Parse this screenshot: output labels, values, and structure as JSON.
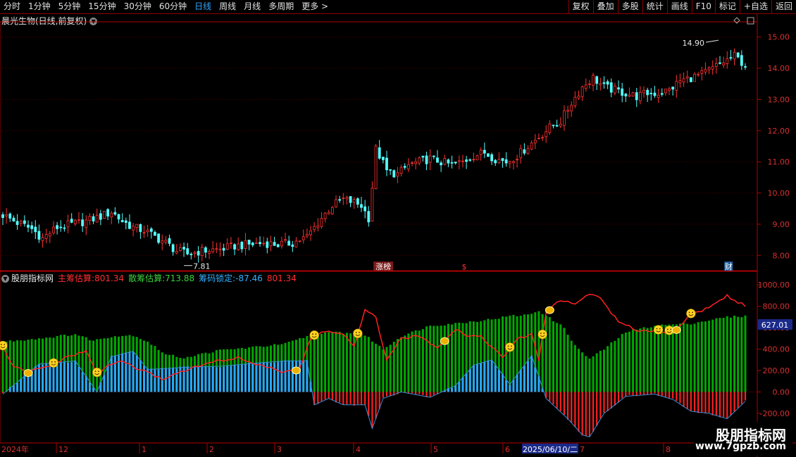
{
  "toolbar": {
    "periods": [
      "分时",
      "1分钟",
      "5分钟",
      "15分钟",
      "30分钟",
      "60分钟",
      "日线",
      "周线",
      "月线",
      "多周期",
      "更多 >"
    ],
    "active_period": "日线",
    "buttons": [
      "复权",
      "叠加",
      "多股",
      "统计",
      "画线",
      "F10",
      "标记",
      "+自选",
      "返回"
    ]
  },
  "chart_title": "晨光生物(日线,前复权)",
  "indicator": {
    "name": "股朋指标网",
    "main_label": "主筹估算:",
    "main_value": "801.34",
    "scatter_label": "散筹估算:",
    "scatter_value": "713.88",
    "lock_label": "筹码锁定:",
    "lock_value": "-87.46",
    "extra_value": "801.34",
    "cursor_value": "627.01"
  },
  "annotations": {
    "high_label": "14.90",
    "low_label": "7.81",
    "event_zhangbang": "涨榜",
    "event_s": "$",
    "event_cai": "财"
  },
  "xaxis": {
    "year_label": "2024年",
    "months": [
      "12",
      "1",
      "2",
      "3",
      "4",
      "5",
      "6",
      "7",
      "8"
    ],
    "highlight_date": "2025/06/10/二"
  },
  "watermark": {
    "line1": "股朋指标网",
    "line2": "www.7gpzb.com"
  },
  "colors": {
    "up": "#ff3232",
    "down": "#54ffff",
    "green": "#00a800",
    "blue": "#29a8ff",
    "red": "#ff2020",
    "line": "#ff2020",
    "axis": "#b00000"
  },
  "chart_data": [
    {
      "type": "candlestick",
      "title": "晨光生物(日线,前复权)",
      "ylim": [
        7.6,
        15.4
      ],
      "yticks": [
        8.0,
        9.0,
        10.0,
        11.0,
        12.0,
        13.0,
        14.0,
        15.0
      ],
      "close_path": [
        [
          0,
          9.3
        ],
        [
          4,
          9.05
        ],
        [
          8,
          8.85
        ],
        [
          11,
          8.55
        ],
        [
          15,
          8.9
        ],
        [
          19,
          9.0
        ],
        [
          23,
          9.1
        ],
        [
          27,
          9.25
        ],
        [
          30,
          9.4
        ],
        [
          33,
          9.1
        ],
        [
          36,
          8.9
        ],
        [
          39,
          8.8
        ],
        [
          42,
          8.6
        ],
        [
          45,
          8.4
        ],
        [
          48,
          8.15
        ],
        [
          51,
          8.05
        ],
        [
          55,
          8.15
        ],
        [
          60,
          8.2
        ],
        [
          64,
          8.3
        ],
        [
          68,
          8.35
        ],
        [
          72,
          8.4
        ],
        [
          76,
          8.35
        ],
        [
          80,
          8.4
        ],
        [
          84,
          8.6
        ],
        [
          88,
          9.2
        ],
        [
          91,
          9.6
        ],
        [
          94,
          9.8
        ],
        [
          97,
          9.7
        ],
        [
          99,
          9.6
        ],
        [
          101,
          9.2
        ],
        [
          102,
          10.2
        ],
        [
          103,
          11.4
        ],
        [
          104,
          11.2
        ],
        [
          106,
          10.7
        ],
        [
          109,
          10.6
        ],
        [
          112,
          10.9
        ],
        [
          115,
          11.0
        ],
        [
          118,
          11.1
        ],
        [
          121,
          11.0
        ],
        [
          124,
          10.9
        ],
        [
          127,
          11.0
        ],
        [
          130,
          11.2
        ],
        [
          133,
          11.3
        ],
        [
          136,
          11.1
        ],
        [
          139,
          11.0
        ],
        [
          142,
          11.2
        ],
        [
          145,
          11.5
        ],
        [
          148,
          11.8
        ],
        [
          151,
          12.1
        ],
        [
          154,
          12.3
        ],
        [
          157,
          12.9
        ],
        [
          160,
          13.4
        ],
        [
          163,
          13.7
        ],
        [
          166,
          13.4
        ],
        [
          169,
          13.3
        ],
        [
          172,
          13.2
        ],
        [
          175,
          13.1
        ],
        [
          178,
          13.2
        ],
        [
          181,
          13.2
        ],
        [
          184,
          13.3
        ],
        [
          187,
          13.6
        ],
        [
          190,
          13.7
        ],
        [
          193,
          13.8
        ],
        [
          196,
          14.0
        ],
        [
          199,
          14.2
        ],
        [
          202,
          14.4
        ],
        [
          205,
          14.1
        ]
      ],
      "high": 14.9,
      "low": 7.81
    },
    {
      "type": "bar+line",
      "title": "股朋指标网",
      "ylim": [
        -450,
        1100
      ],
      "yticks": [
        -400.0,
        -200.0,
        0.0,
        200.0,
        400.0,
        600.0,
        800.0,
        1000.0
      ],
      "series": [
        {
          "name": "散筹估算",
          "values": [
            [
              0,
              470
            ],
            [
              10,
              500
            ],
            [
              20,
              540
            ],
            [
              25,
              480
            ],
            [
              30,
              520
            ],
            [
              36,
              530
            ],
            [
              40,
              470
            ],
            [
              45,
              350
            ],
            [
              50,
              320
            ],
            [
              60,
              390
            ],
            [
              70,
              420
            ],
            [
              78,
              450
            ],
            [
              85,
              530
            ],
            [
              92,
              560
            ],
            [
              100,
              530
            ],
            [
              105,
              400
            ],
            [
              110,
              520
            ],
            [
              118,
              620
            ],
            [
              125,
              640
            ],
            [
              135,
              680
            ],
            [
              140,
              710
            ],
            [
              145,
              720
            ],
            [
              148,
              760
            ],
            [
              151,
              690
            ],
            [
              155,
              600
            ],
            [
              158,
              430
            ],
            [
              162,
              310
            ],
            [
              166,
              400
            ],
            [
              172,
              560
            ],
            [
              180,
              620
            ],
            [
              190,
              640
            ],
            [
              200,
              700
            ],
            [
              205,
              710
            ]
          ]
        },
        {
          "name": "主筹估算",
          "values": [
            [
              0,
              420
            ],
            [
              3,
              230
            ],
            [
              7,
              190
            ],
            [
              13,
              240
            ],
            [
              18,
              330
            ],
            [
              23,
              380
            ],
            [
              26,
              170
            ],
            [
              30,
              260
            ],
            [
              33,
              290
            ],
            [
              37,
              220
            ],
            [
              40,
              180
            ],
            [
              44,
              120
            ],
            [
              50,
              200
            ],
            [
              58,
              280
            ],
            [
              65,
              320
            ],
            [
              70,
              260
            ],
            [
              77,
              190
            ],
            [
              82,
              220
            ],
            [
              85,
              500
            ],
            [
              89,
              570
            ],
            [
              94,
              540
            ],
            [
              97,
              420
            ],
            [
              100,
              760
            ],
            [
              103,
              700
            ],
            [
              106,
              290
            ],
            [
              110,
              500
            ],
            [
              115,
              520
            ],
            [
              120,
              420
            ],
            [
              125,
              590
            ],
            [
              128,
              530
            ],
            [
              132,
              520
            ],
            [
              138,
              320
            ],
            [
              142,
              490
            ],
            [
              146,
              540
            ],
            [
              148,
              300
            ],
            [
              150,
              750
            ],
            [
              154,
              860
            ],
            [
              158,
              820
            ],
            [
              162,
              920
            ],
            [
              165,
              880
            ],
            [
              170,
              650
            ],
            [
              175,
              580
            ],
            [
              180,
              570
            ],
            [
              185,
              560
            ],
            [
              190,
              720
            ],
            [
              195,
              790
            ],
            [
              200,
              900
            ],
            [
              205,
              801
            ]
          ]
        },
        {
          "name": "筹码锁定",
          "values": [
            [
              0,
              -20
            ],
            [
              10,
              260
            ],
            [
              20,
              290
            ],
            [
              26,
              0
            ],
            [
              30,
              330
            ],
            [
              36,
              380
            ],
            [
              40,
              210
            ],
            [
              45,
              220
            ],
            [
              50,
              230
            ],
            [
              60,
              240
            ],
            [
              70,
              270
            ],
            [
              78,
              290
            ],
            [
              84,
              290
            ],
            [
              86,
              -120
            ],
            [
              90,
              -60
            ],
            [
              94,
              -120
            ],
            [
              100,
              -120
            ],
            [
              102,
              -340
            ],
            [
              105,
              -60
            ],
            [
              110,
              0
            ],
            [
              118,
              -50
            ],
            [
              125,
              60
            ],
            [
              130,
              250
            ],
            [
              135,
              300
            ],
            [
              140,
              70
            ],
            [
              146,
              340
            ],
            [
              150,
              -60
            ],
            [
              156,
              -250
            ],
            [
              160,
              -400
            ],
            [
              162,
              -420
            ],
            [
              166,
              -200
            ],
            [
              172,
              -40
            ],
            [
              180,
              -20
            ],
            [
              185,
              -70
            ],
            [
              190,
              -180
            ],
            [
              195,
              -200
            ],
            [
              200,
              -250
            ],
            [
              205,
              -87
            ]
          ]
        }
      ],
      "signals": [
        0,
        7,
        14,
        26,
        81,
        86,
        98,
        122,
        140,
        149,
        151,
        181,
        184,
        186,
        190
      ]
    }
  ]
}
